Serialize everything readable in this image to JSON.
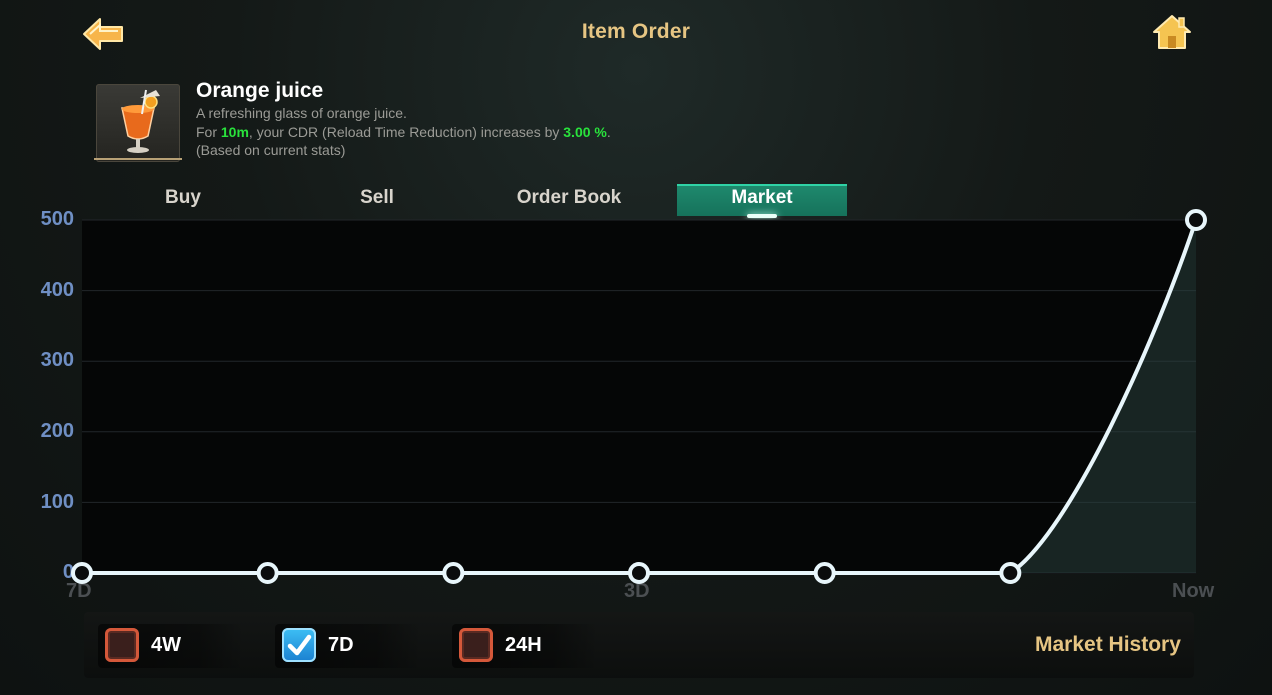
{
  "header": {
    "title": "Item Order",
    "back_icon": "back-arrow-icon",
    "home_icon": "home-icon"
  },
  "item": {
    "name": "Orange juice",
    "desc_line1": "A refreshing glass of orange juice.",
    "desc_prefix": "For ",
    "duration": "10m",
    "desc_middle": ", your CDR (Reload Time Reduction) increases by ",
    "percent": "3.00 %",
    "desc_suffix": ".",
    "desc_line3": "(Based on current stats)",
    "highlight_color": "#29e23c"
  },
  "tabs": [
    {
      "label": "Buy"
    },
    {
      "label": "Sell"
    },
    {
      "label": "Order Book"
    },
    {
      "label": "Market",
      "active": true
    }
  ],
  "chart_data": {
    "type": "line",
    "y_ticks": [
      "0",
      "100",
      "200",
      "300",
      "400",
      "500"
    ],
    "x_ticks": [
      "7D",
      "3D",
      "Now"
    ],
    "ylim": [
      0,
      500
    ],
    "series": [
      {
        "values": [
          0,
          0,
          0,
          0,
          0,
          0,
          500
        ]
      }
    ],
    "grid": true,
    "line_color": "#e8f6fb",
    "axis_color": "#6f8fc4"
  },
  "filters": [
    {
      "label": "4W",
      "checked": false
    },
    {
      "label": "7D",
      "checked": true
    },
    {
      "label": "24H",
      "checked": false
    }
  ],
  "market_history": "Market History"
}
